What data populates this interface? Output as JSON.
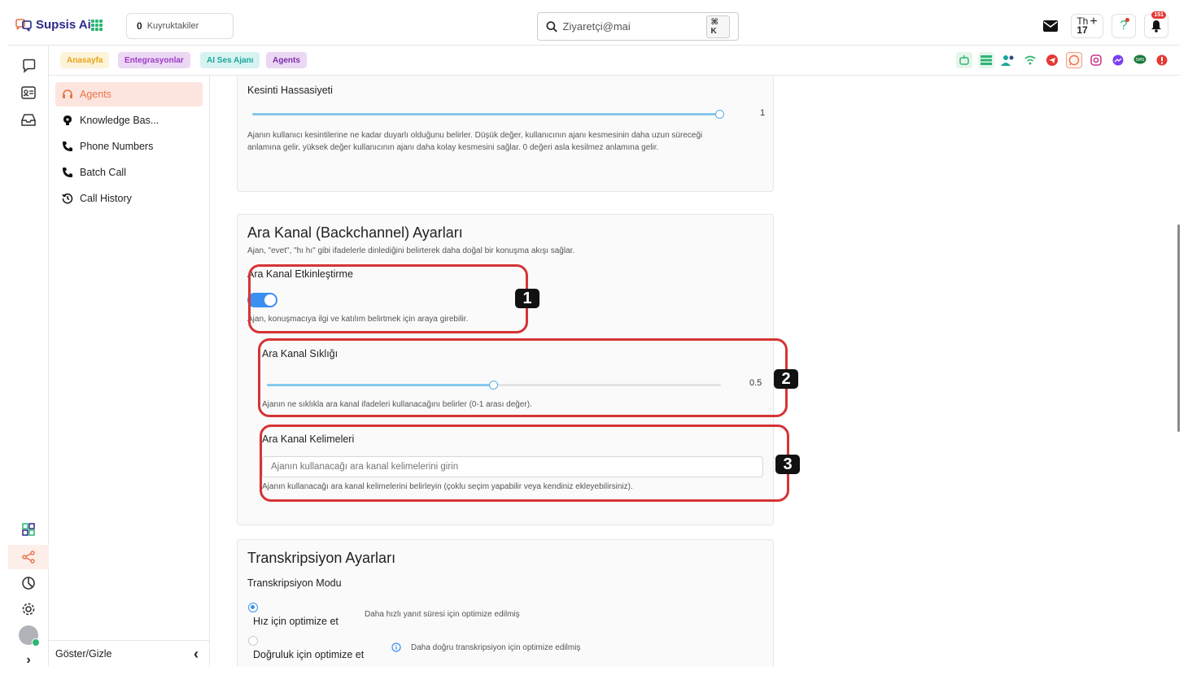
{
  "brand": {
    "name": "Supsis Ai"
  },
  "header": {
    "queue_count": "0",
    "queue_label": "Kuyruktakiler",
    "search_value": "Ziyaretçi@mai",
    "search_shortcut": "⌘ K",
    "calendar_day": "Th",
    "calendar_date": "17",
    "notification_count": "151"
  },
  "tabs": [
    {
      "label": "Anasayfa",
      "bg": "#fdf3d9",
      "color": "#e8a51c"
    },
    {
      "label": "Entegrasyonlar",
      "bg": "#ecd7f5",
      "color": "#9b3cc4"
    },
    {
      "label": "AI Ses Ajanı",
      "bg": "#d7f3f1",
      "color": "#1ba59a"
    },
    {
      "label": "Agents",
      "bg": "#ecd7f5",
      "color": "#7b2fa7"
    }
  ],
  "channels": [
    "bot-icon",
    "list-icon",
    "users-icon",
    "wifi-icon",
    "telegram-icon",
    "whatsapp-icon",
    "instagram-icon",
    "messenger-icon",
    "sms-icon",
    "alert-icon"
  ],
  "sidebar": {
    "items": [
      {
        "label": "Agents",
        "icon": "headset-icon"
      },
      {
        "label": "Knowledge Bas...",
        "icon": "brain-icon"
      },
      {
        "label": "Phone Numbers",
        "icon": "phone-icon"
      },
      {
        "label": "Batch Call",
        "icon": "phone-icon"
      },
      {
        "label": "Call History",
        "icon": "history-icon"
      }
    ],
    "footer_label": "Göster/Gizle"
  },
  "interruption": {
    "label": "Kesinti Hassasiyeti",
    "value": "1",
    "level": 1.0,
    "help_line1": "Ajanın kullanıcı kesintilerine ne kadar duyarlı olduğunu belirler. Düşük değer, kullanıcının ajanı kesmesinin daha uzun süreceği",
    "help_line2": "anlamına gelir, yüksek değer kullanıcının ajanı daha kolay kesmesini sağlar. 0 değeri asla kesilmez anlamına gelir."
  },
  "backchannel": {
    "title": "Ara Kanal (Backchannel) Ayarları",
    "subtitle": "Ajan, \"evet\", \"hı hı\" gibi ifadelerle dinlediğini belirterek daha doğal bir konuşma akışı sağlar.",
    "enable_label": "Ara Kanal Etkinleştirme",
    "enable_help": "Ajan, konuşmacıya ilgi ve katılım belirtmek için araya girebilir.",
    "enabled": true,
    "freq_label": "Ara Kanal Sıklığı",
    "freq_value": "0.5",
    "freq_level": 0.5,
    "freq_help": "Ajanın ne sıklıkla ara kanal ifadeleri kullanacağını belirler (0-1 arası değer).",
    "words_label": "Ara Kanal Kelimeleri",
    "words_placeholder": "Ajanın kullanacağı ara kanal kelimelerini girin",
    "words_help": "Ajanın kullanacağı ara kanal kelimelerini belirleyin (çoklu seçim yapabilir veya kendiniz ekleyebilirsiniz)."
  },
  "annotations": [
    "1",
    "2",
    "3"
  ],
  "transcription": {
    "title": "Transkripsiyon Ayarları",
    "mode_label": "Transkripsiyon Modu",
    "options": [
      {
        "label": "Hız için optimize et",
        "desc": "Daha hızlı yanıt süresi için optimize edilmiş",
        "selected": true
      },
      {
        "label": "Doğruluk için optimize et",
        "desc": "Daha doğru transkripsiyon için optimize edilmiş",
        "selected": false
      }
    ]
  }
}
